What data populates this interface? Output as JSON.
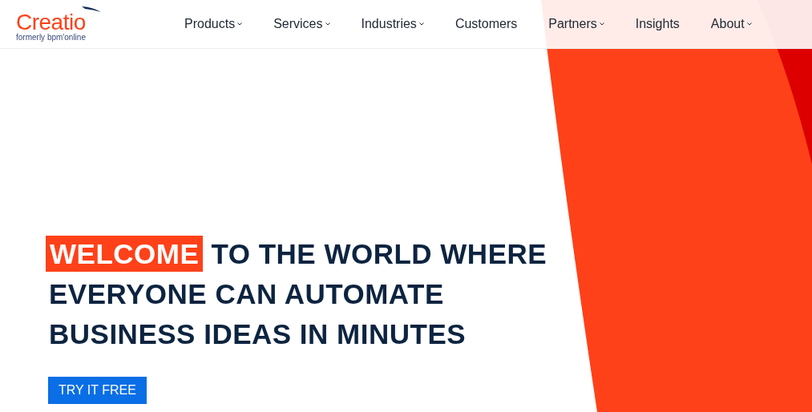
{
  "logo": {
    "name": "Creatio",
    "tagline": "formerly bpm'online"
  },
  "nav": [
    {
      "label": "Products",
      "has_menu": true
    },
    {
      "label": "Services",
      "has_menu": true
    },
    {
      "label": "Industries",
      "has_menu": true
    },
    {
      "label": "Customers",
      "has_menu": false
    },
    {
      "label": "Partners",
      "has_menu": true
    },
    {
      "label": "Insights",
      "has_menu": false
    },
    {
      "label": "About",
      "has_menu": true
    }
  ],
  "hero": {
    "highlight": "WELCOME",
    "lines": [
      "TO THE WORLD WHERE",
      "EVERYONE CAN AUTOMATE",
      "BUSINESS IDEAS IN MINUTES"
    ],
    "button": "TRY IT FREE"
  }
}
